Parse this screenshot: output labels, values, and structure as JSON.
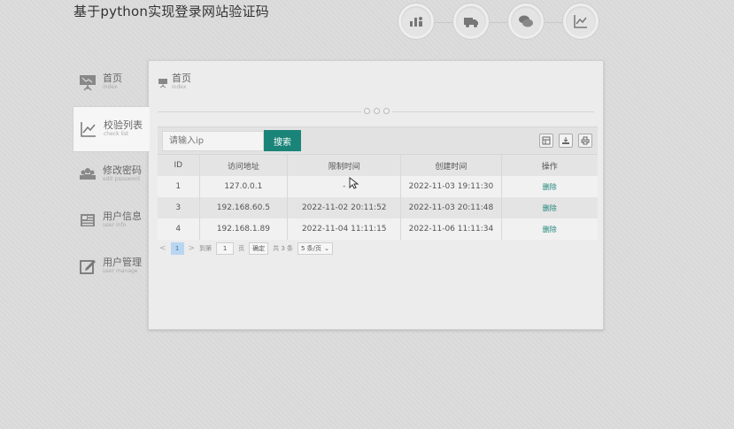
{
  "app": {
    "title": "基于python实现登录网站验证码"
  },
  "top_icons": [
    {
      "icon": "users-stats-icon"
    },
    {
      "icon": "truck-icon"
    },
    {
      "icon": "chat-icon"
    },
    {
      "icon": "line-chart-icon"
    }
  ],
  "sidebar": {
    "items": [
      {
        "label": "首页",
        "sub": "index",
        "icon": "presentation-icon"
      },
      {
        "label": "校验列表",
        "sub": "check list",
        "icon": "line-chart-icon",
        "active": true
      },
      {
        "label": "修改密码",
        "sub": "edit password",
        "icon": "users-icon"
      },
      {
        "label": "用户信息",
        "sub": "user info",
        "icon": "id-card-icon"
      },
      {
        "label": "用户管理",
        "sub": "user manage",
        "icon": "edit-icon"
      }
    ]
  },
  "breadcrumb": {
    "label": "首页",
    "sub": "index"
  },
  "toolbar": {
    "search_placeholder": "请输入ip",
    "search_button": "搜索",
    "tools": [
      "columns-icon",
      "export-icon",
      "print-icon"
    ]
  },
  "table": {
    "headers": [
      "ID",
      "访问地址",
      "限制时间",
      "创建时间",
      "操作"
    ],
    "rows": [
      {
        "id": "1",
        "ip": "127.0.0.1",
        "limit": "-",
        "created": "2022-11-03 19:11:30",
        "op": "删除"
      },
      {
        "id": "3",
        "ip": "192.168.60.5",
        "limit": "2022-11-02 20:11:52",
        "created": "2022-11-03 20:11:48",
        "op": "删除"
      },
      {
        "id": "4",
        "ip": "192.168.1.89",
        "limit": "2022-11-04 11:11:15",
        "created": "2022-11-06 11:11:34",
        "op": "删除"
      }
    ]
  },
  "pager": {
    "prev": "<",
    "current": "1",
    "next": ">",
    "goto_label": "到第",
    "goto_value": "1",
    "page_unit": "页",
    "ok": "确定",
    "total": "共 3 条",
    "page_size": "5 条/页",
    "caret": "⌄"
  }
}
